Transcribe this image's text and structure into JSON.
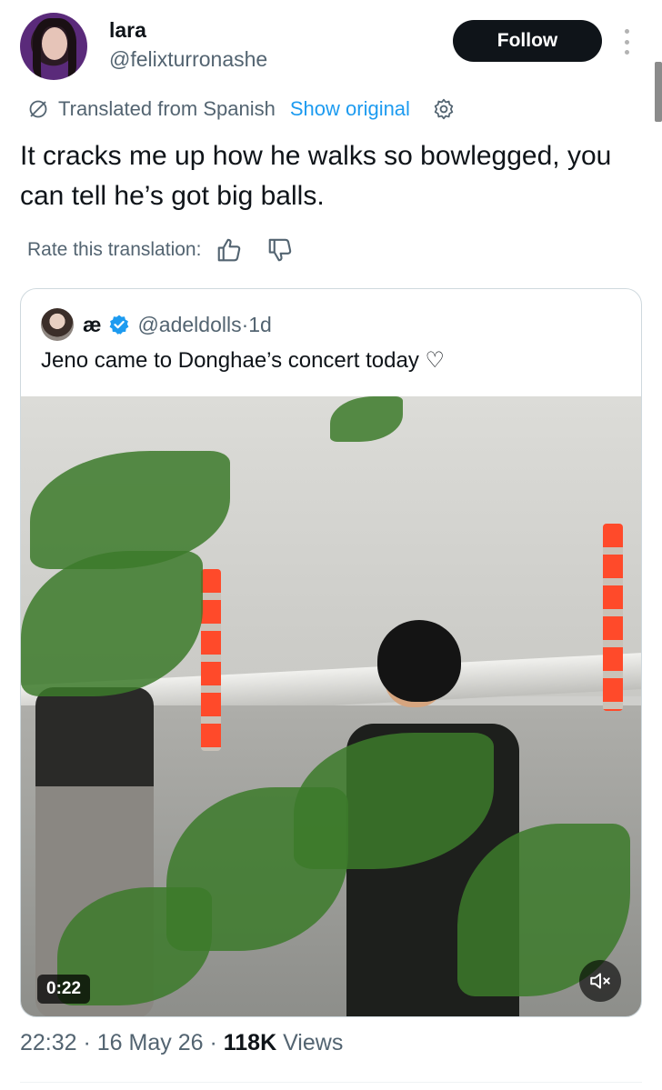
{
  "author": {
    "display_name": "lara",
    "handle": "@felixturronashe",
    "follow_label": "Follow"
  },
  "translation": {
    "translated_from": "Translated from Spanish",
    "show_original": "Show original",
    "rate_label": "Rate this translation:"
  },
  "tweet": {
    "text": "It cracks me up how he walks so bowlegged, you can tell he’s got big balls."
  },
  "quote": {
    "name": "æ",
    "handle": "@adeldolls",
    "separator": " · ",
    "time": "1d",
    "text": "Jeno came to Donghae’s concert today ♡",
    "video_duration": "0:22"
  },
  "meta": {
    "time": "22:32",
    "sep1": " · ",
    "date": "16 May 26",
    "sep2": " · ",
    "views_count": "118K",
    "views_label": " Views"
  },
  "icons": {
    "more": "more-vertical-icon",
    "globe": "globe-slash-icon",
    "settings": "gear-icon",
    "like": "thumbs-up-icon",
    "dislike": "thumbs-down-icon",
    "verified": "verified-badge-icon",
    "mute": "speaker-muted-icon"
  },
  "colors": {
    "accent": "#1d9bf0",
    "text_primary": "#0f1419",
    "text_secondary": "#536471",
    "follow_bg": "#0f1419"
  }
}
